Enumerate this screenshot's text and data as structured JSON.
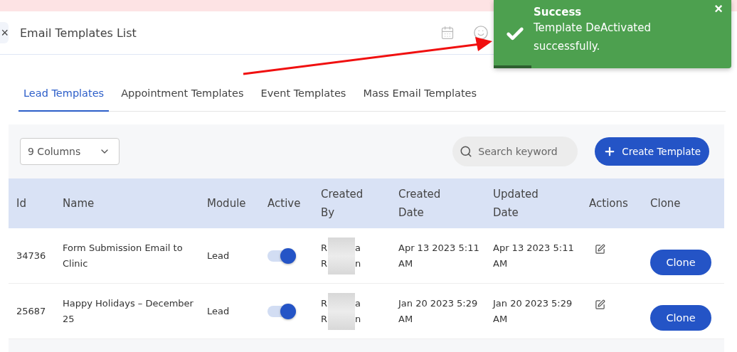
{
  "header": {
    "close_glyph": "×",
    "title": "Email Templates List"
  },
  "tabs": [
    {
      "label": "Lead Templates",
      "selected": true
    },
    {
      "label": "Appointment Templates",
      "selected": false
    },
    {
      "label": "Event Templates",
      "selected": false
    },
    {
      "label": "Mass Email Templates",
      "selected": false
    }
  ],
  "toolbar": {
    "columns_select": "9 Columns",
    "search": {
      "placeholder": "Search keyword"
    },
    "create_button": "Create Template"
  },
  "table": {
    "columns": [
      "Id",
      "Name",
      "Module",
      "Active",
      "Created By",
      "Created Date",
      "Updated Date",
      "Actions",
      "Clone"
    ],
    "rows": [
      {
        "id": "34736",
        "name": "Form Submission Email to Clinic",
        "module": "Lead",
        "active": true,
        "created_by": [
          [
            "R",
            "a"
          ],
          [
            "R",
            "n"
          ]
        ],
        "created_date": "Apr 13 2023 5:11 AM",
        "updated_date": "Apr 13 2023 5:11 AM",
        "clone": "Clone"
      },
      {
        "id": "25687",
        "name": "Happy Holidays – December 25",
        "module": "Lead",
        "active": true,
        "created_by": [
          [
            "R",
            "a"
          ],
          [
            "R",
            "n"
          ]
        ],
        "created_date": "Jan 20 2023 5:29 AM",
        "updated_date": "Jan 20 2023 5:29 AM",
        "clone": "Clone"
      }
    ]
  },
  "toast": {
    "title": "Success",
    "message": "Template DeActivated successfully.",
    "close_glyph": "×",
    "level": 0.16
  }
}
